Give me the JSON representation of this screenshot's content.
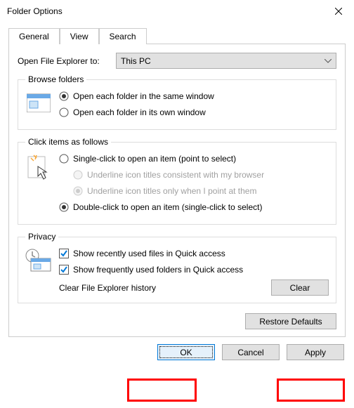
{
  "window": {
    "title": "Folder Options"
  },
  "tabs": {
    "general": "General",
    "view": "View",
    "search": "Search"
  },
  "open_to": {
    "label": "Open File Explorer to:",
    "value": "This PC"
  },
  "browse": {
    "legend": "Browse folders",
    "same_window": "Open each folder in the same window",
    "own_window": "Open each folder in its own window"
  },
  "click_items": {
    "legend": "Click items as follows",
    "single": "Single-click to open an item (point to select)",
    "underline_browser": "Underline icon titles consistent with my browser",
    "underline_point": "Underline icon titles only when I point at them",
    "double": "Double-click to open an item (single-click to select)"
  },
  "privacy": {
    "legend": "Privacy",
    "recent_files": "Show recently used files in Quick access",
    "frequent_folders": "Show frequently used folders in Quick access",
    "clear_label": "Clear File Explorer history",
    "clear_btn": "Clear"
  },
  "restore": "Restore Defaults",
  "buttons": {
    "ok": "OK",
    "cancel": "Cancel",
    "apply": "Apply"
  }
}
